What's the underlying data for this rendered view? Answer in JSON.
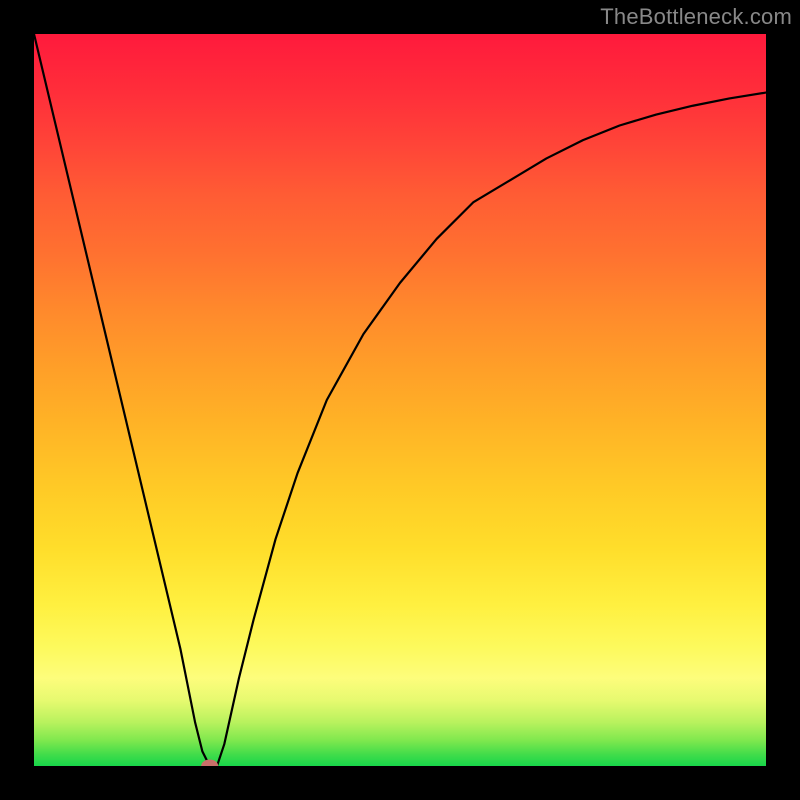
{
  "watermark": "TheBottleneck.com",
  "chart_data": {
    "type": "line",
    "title": "",
    "xlabel": "",
    "ylabel": "",
    "xlim": [
      0,
      100
    ],
    "ylim": [
      0,
      100
    ],
    "grid": false,
    "legend": false,
    "series": [
      {
        "name": "curve",
        "x": [
          0,
          5,
          10,
          15,
          20,
          22,
          23,
          24,
          25,
          26,
          28,
          30,
          33,
          36,
          40,
          45,
          50,
          55,
          60,
          65,
          70,
          75,
          80,
          85,
          90,
          95,
          100
        ],
        "y": [
          100,
          79,
          58,
          37,
          16,
          6,
          2,
          0,
          0,
          3,
          12,
          20,
          31,
          40,
          50,
          59,
          66,
          72,
          77,
          80,
          83,
          85.5,
          87.5,
          89,
          90.2,
          91.2,
          92
        ]
      }
    ],
    "markers": [
      {
        "name": "min-marker",
        "x": 24,
        "y": 0,
        "color": "#c9706a"
      }
    ],
    "gradient_stops": [
      {
        "pos": 0.0,
        "color": "#ff1a3c"
      },
      {
        "pos": 0.5,
        "color": "#ffb526"
      },
      {
        "pos": 0.85,
        "color": "#fdfd7c"
      },
      {
        "pos": 1.0,
        "color": "#18d64a"
      }
    ]
  }
}
